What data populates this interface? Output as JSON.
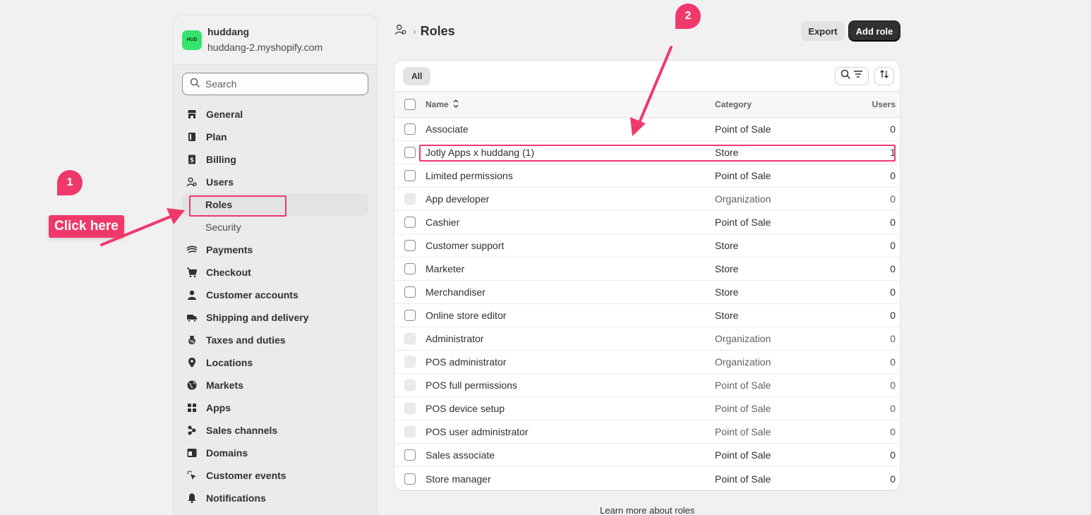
{
  "store": {
    "avatar_text": "HUD",
    "name": "huddang",
    "domain": "huddang-2.myshopify.com"
  },
  "search": {
    "placeholder": "Search"
  },
  "nav": {
    "general": "General",
    "plan": "Plan",
    "billing": "Billing",
    "users": "Users",
    "roles": "Roles",
    "security": "Security",
    "payments": "Payments",
    "checkout": "Checkout",
    "customer_accounts": "Customer accounts",
    "shipping": "Shipping and delivery",
    "taxes": "Taxes and duties",
    "locations": "Locations",
    "markets": "Markets",
    "apps": "Apps",
    "sales_channels": "Sales channels",
    "domains": "Domains",
    "customer_events": "Customer events",
    "notifications": "Notifications"
  },
  "page": {
    "title": "Roles",
    "export_label": "Export",
    "add_label": "Add role"
  },
  "table": {
    "tab_all": "All",
    "headers": {
      "name": "Name",
      "category": "Category",
      "users": "Users"
    },
    "rows": [
      {
        "name": "Associate",
        "category": "Point of Sale",
        "users": "0"
      },
      {
        "name": "Jotly Apps x huddang (1)",
        "category": "Store",
        "users": "1"
      },
      {
        "name": "Limited permissions",
        "category": "Point of Sale",
        "users": "0"
      },
      {
        "name": "App developer",
        "category": "Organization",
        "users": "0"
      },
      {
        "name": "Cashier",
        "category": "Point of Sale",
        "users": "0"
      },
      {
        "name": "Customer support",
        "category": "Store",
        "users": "0"
      },
      {
        "name": "Marketer",
        "category": "Store",
        "users": "0"
      },
      {
        "name": "Merchandiser",
        "category": "Store",
        "users": "0"
      },
      {
        "name": "Online store editor",
        "category": "Store",
        "users": "0"
      },
      {
        "name": "Administrator",
        "category": "Organization",
        "users": "0"
      },
      {
        "name": "POS administrator",
        "category": "Organization",
        "users": "0"
      },
      {
        "name": "POS full permissions",
        "category": "Point of Sale",
        "users": "0"
      },
      {
        "name": "POS device setup",
        "category": "Point of Sale",
        "users": "0"
      },
      {
        "name": "POS user administrator",
        "category": "Point of Sale",
        "users": "0"
      },
      {
        "name": "Sales associate",
        "category": "Point of Sale",
        "users": "0"
      },
      {
        "name": "Store manager",
        "category": "Point of Sale",
        "users": "0"
      }
    ]
  },
  "footer": {
    "learn_more": "Learn more about roles"
  },
  "annotations": {
    "step1": "1",
    "step2": "2",
    "callout": "Click here",
    "color": "#f0386b"
  }
}
